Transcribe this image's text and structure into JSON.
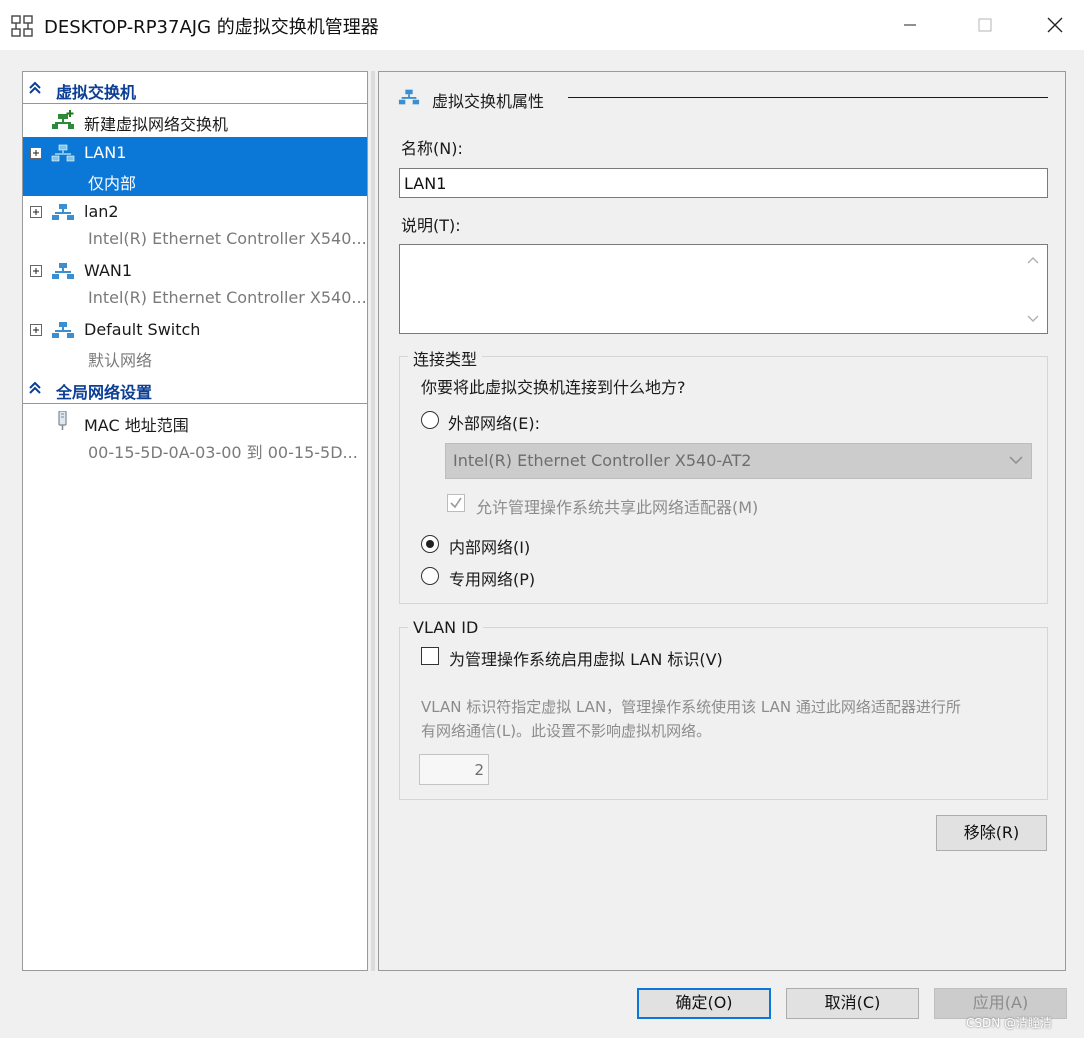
{
  "window": {
    "title": "DESKTOP-RP37AJG 的虚拟交换机管理器",
    "minimize_icon": "minimize-icon",
    "maximize_icon": "maximize-icon",
    "close_icon": "close-icon"
  },
  "tree": {
    "section_switches": "虚拟交换机",
    "new_switch": "新建虚拟网络交换机",
    "switches": [
      {
        "name": "LAN1",
        "sub": "仅内部",
        "selected": true
      },
      {
        "name": "lan2",
        "sub": "Intel(R) Ethernet Controller X540...",
        "selected": false
      },
      {
        "name": "WAN1",
        "sub": "Intel(R) Ethernet Controller X540...",
        "selected": false
      },
      {
        "name": "Default Switch",
        "sub": "默认网络",
        "selected": false
      }
    ],
    "section_global": "全局网络设置",
    "mac_range": {
      "name": "MAC 地址范围",
      "sub": "00-15-5D-0A-03-00 到 00-15-5D..."
    }
  },
  "props": {
    "heading": "虚拟交换机属性",
    "name_label": "名称(N):",
    "name_value": "LAN1",
    "desc_label": "说明(T):",
    "desc_value": "",
    "conn_type_title": "连接类型",
    "conn_question": "你要将此虚拟交换机连接到什么地方?",
    "external_label": "外部网络(E):",
    "adapter_value": "Intel(R) Ethernet Controller X540-AT2",
    "allow_mgmt_label": "允许管理操作系统共享此网络适配器(M)",
    "allow_mgmt_checked": true,
    "internal_label": "内部网络(I)",
    "private_label": "专用网络(P)",
    "selected_connection": "internal",
    "vlan_title": "VLAN ID",
    "vlan_check_label": "为管理操作系统启用虚拟 LAN 标识(V)",
    "vlan_checked": false,
    "vlan_desc_line1": "VLAN 标识符指定虚拟 LAN，管理操作系统使用该 LAN 通过此网络适配器进行所",
    "vlan_desc_line2": "有网络通信(L)。此设置不影响虚拟机网络。",
    "vlan_value": "2",
    "remove_button": "移除(R)"
  },
  "footer": {
    "ok_button": "确定(O)",
    "cancel_button": "取消(C)",
    "apply_button": "应用(A)"
  },
  "watermark": "CSDN @清瞳清",
  "colors": {
    "selection": "#0b78d7",
    "section_header": "#0b3e94",
    "window_bg": "#f0f0f0"
  }
}
